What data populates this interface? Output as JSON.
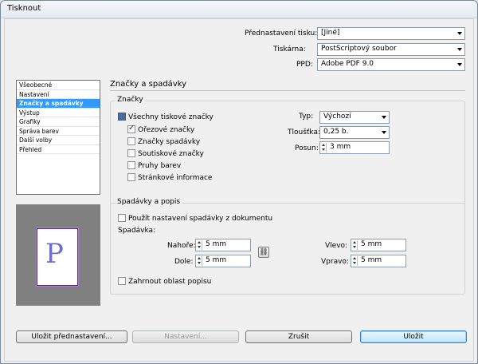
{
  "window": {
    "title": "Tisknout"
  },
  "preset": {
    "label": "Přednastavení tisku:",
    "value": "[Jiné]"
  },
  "printer": {
    "label": "Tiskárna:",
    "value": "PostScriptový soubor"
  },
  "ppd": {
    "label": "PPD:",
    "value": "Adobe PDF 9.0"
  },
  "sidebar": {
    "items": [
      {
        "label": "Všeobecné",
        "selected": false
      },
      {
        "label": "Nastavení",
        "selected": false
      },
      {
        "label": "Značky a spadávky",
        "selected": true
      },
      {
        "label": "Výstup",
        "selected": false
      },
      {
        "label": "Grafiky",
        "selected": false
      },
      {
        "label": "Správa barev",
        "selected": false
      },
      {
        "label": "Další volby",
        "selected": false
      },
      {
        "label": "Přehled",
        "selected": false
      }
    ]
  },
  "preview": {
    "glyph": "P"
  },
  "section": {
    "title": "Značky a spadávky"
  },
  "marks": {
    "legend": "Značky",
    "all_marks": {
      "label": "Všechny tiskové značky",
      "state": "mixed"
    },
    "crop_marks": {
      "label": "Ořezové značky",
      "checked": true
    },
    "bleed_marks": {
      "label": "Značky spadávky",
      "checked": false
    },
    "registration_marks": {
      "label": "Soutiskové značky",
      "checked": false
    },
    "color_bars": {
      "label": "Pruhy barev",
      "checked": false
    },
    "page_info": {
      "label": "Stránkové informace",
      "checked": false
    },
    "type": {
      "label": "Typ:",
      "value": "Výchozí"
    },
    "weight": {
      "label": "Tloušťka:",
      "value": "0,25 b."
    },
    "offset": {
      "label": "Posun:",
      "value": "3 mm"
    }
  },
  "bleed": {
    "legend": "Spadávky a popis",
    "use_doc": {
      "label": "Použít nastavení spadávky z dokumentu",
      "checked": false
    },
    "bleed_label": "Spadávka:",
    "top": {
      "label": "Nahoře:",
      "value": "5 mm"
    },
    "bottom": {
      "label": "Dole:",
      "value": "5 mm"
    },
    "left": {
      "label": "Vlevo:",
      "value": "5 mm"
    },
    "right": {
      "label": "Vpravo:",
      "value": "5 mm"
    },
    "slug": {
      "label": "Zahrnout oblast popisu",
      "checked": false
    }
  },
  "buttons": {
    "save_preset": "Uložit přednastavení...",
    "setup": "Nastavení...",
    "cancel": "Zrušit",
    "save": "Uložit"
  },
  "colors": {
    "selection": "#3399ff",
    "preview_bg": "#808080"
  }
}
